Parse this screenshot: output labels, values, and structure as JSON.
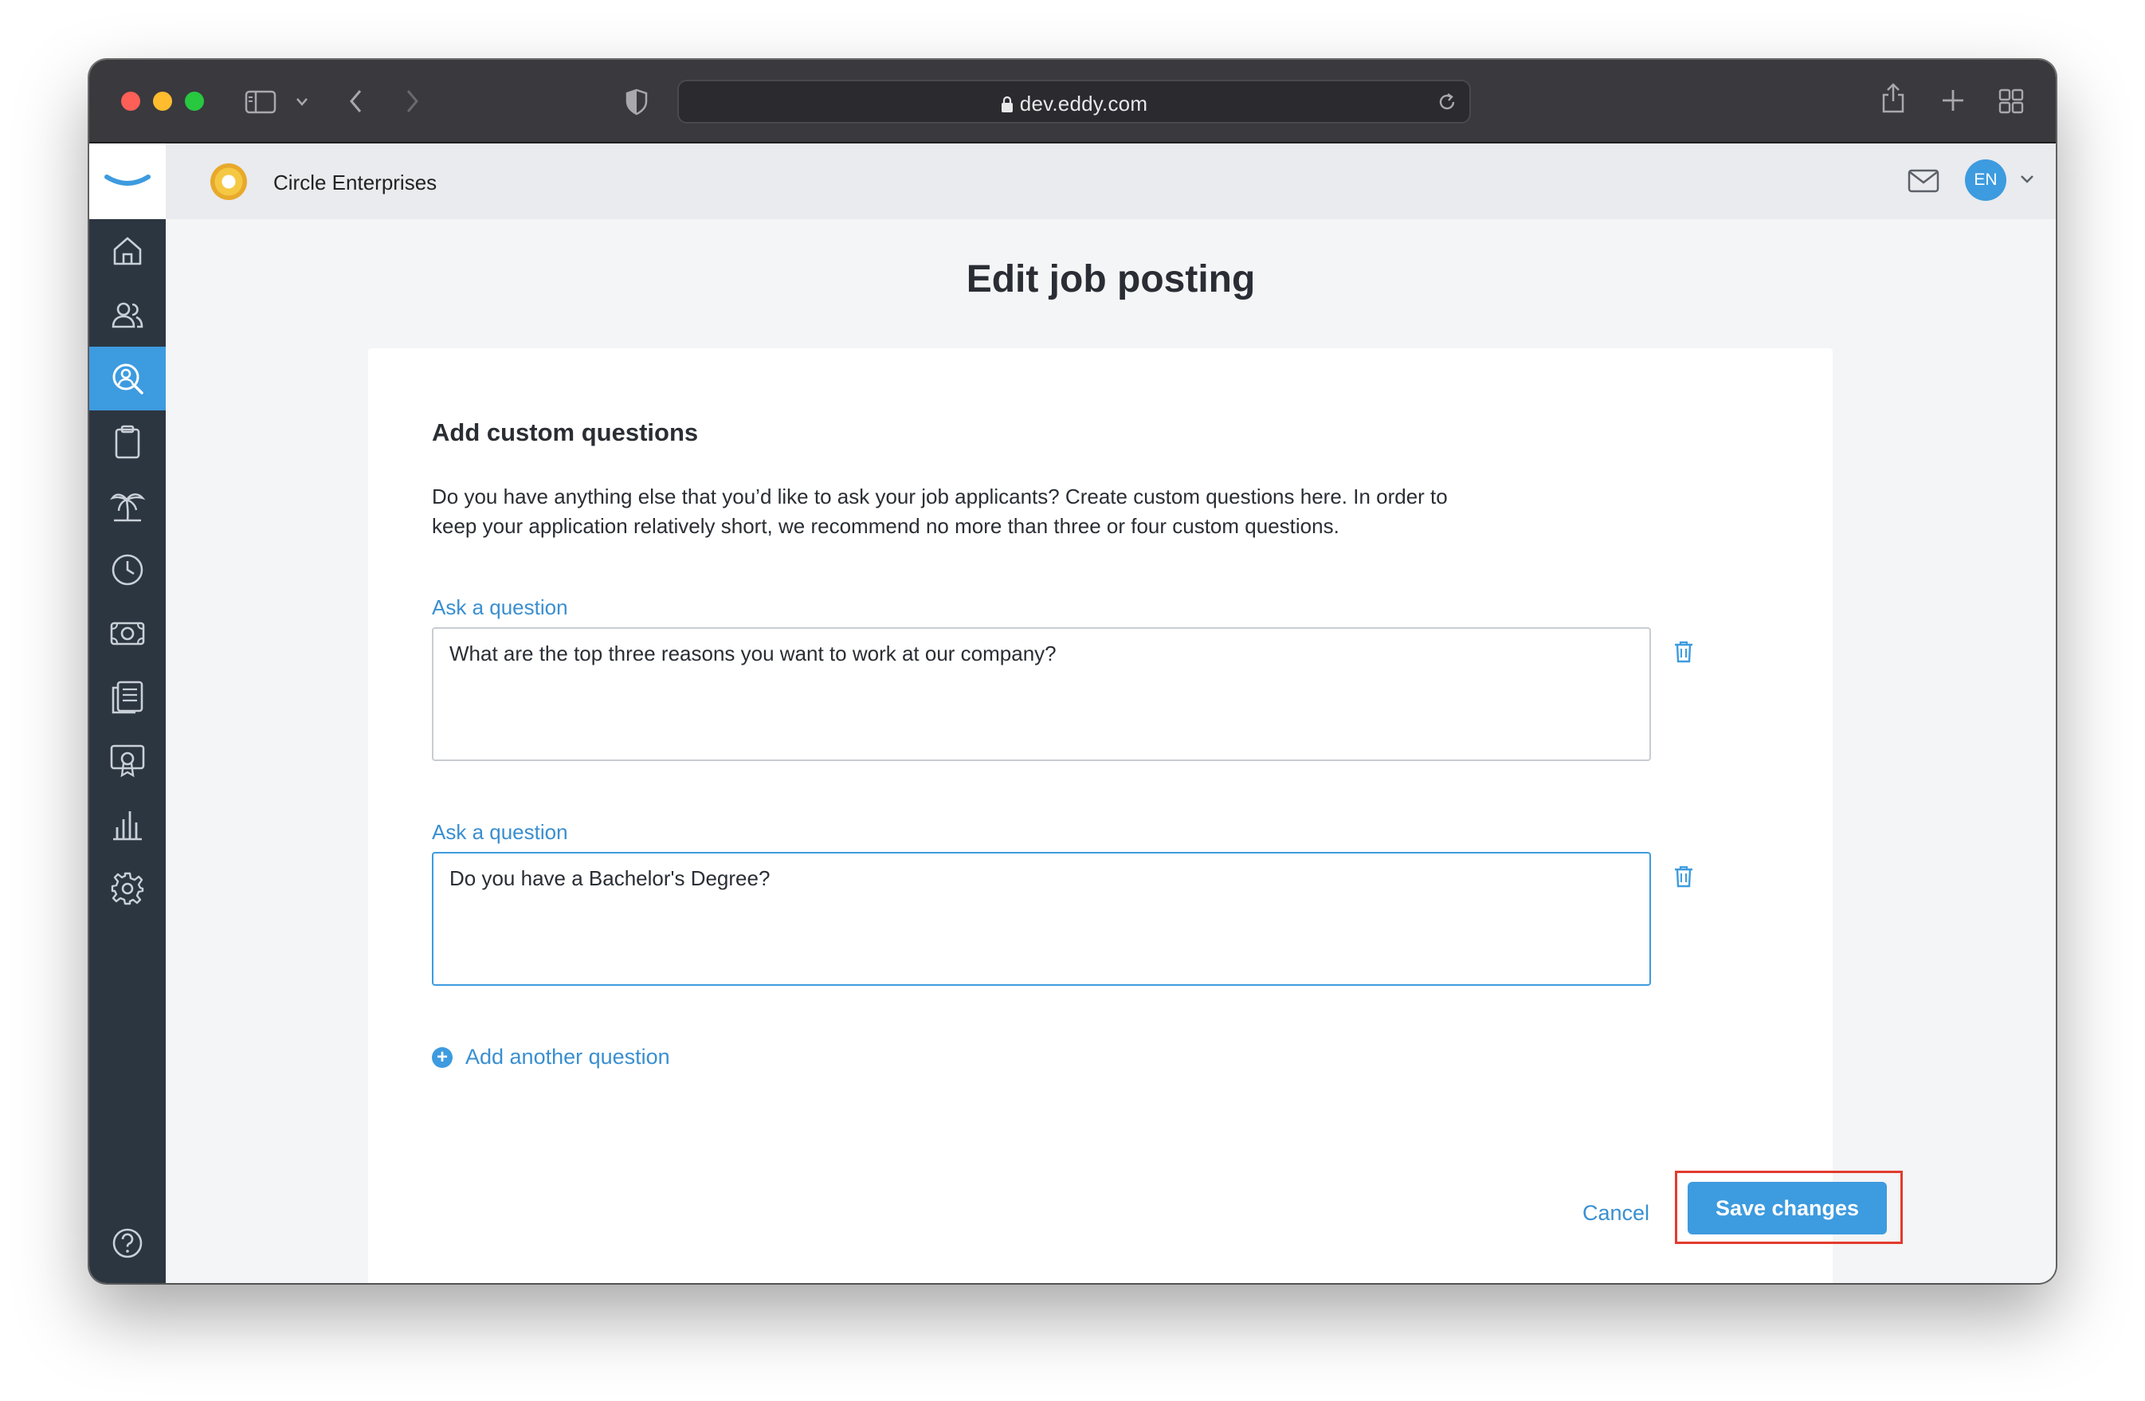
{
  "browser": {
    "url": "dev.eddy.com"
  },
  "header": {
    "company_name": "Circle Enterprises",
    "language": "EN"
  },
  "sidebar": {
    "items": [
      {
        "icon": "home-icon"
      },
      {
        "icon": "people-icon"
      },
      {
        "icon": "hiring-search-icon",
        "active": true
      },
      {
        "icon": "clipboard-icon"
      },
      {
        "icon": "palm-tree-icon"
      },
      {
        "icon": "clock-icon"
      },
      {
        "icon": "payroll-icon"
      },
      {
        "icon": "documents-icon"
      },
      {
        "icon": "training-icon"
      },
      {
        "icon": "reports-icon"
      },
      {
        "icon": "settings-icon"
      }
    ],
    "help_icon": "help-icon"
  },
  "page": {
    "title": "Edit job posting"
  },
  "form": {
    "section_title": "Add custom questions",
    "description": "Do you have anything else that you’d like to ask your job applicants? Create custom questions here. In order to keep your application relatively short, we recommend no more than three or four custom questions.",
    "questions": [
      {
        "label": "Ask a question",
        "value": "What are the top three reasons you want to work at our company?"
      },
      {
        "label": "Ask a question",
        "value": "Do you have a Bachelor's Degree?"
      }
    ],
    "add_label": "Add another question",
    "cancel_label": "Cancel",
    "save_label": "Save changes"
  },
  "colors": {
    "accent": "#3d9bdf",
    "sidebar": "#2c3641",
    "highlight": "#e23b2e"
  }
}
